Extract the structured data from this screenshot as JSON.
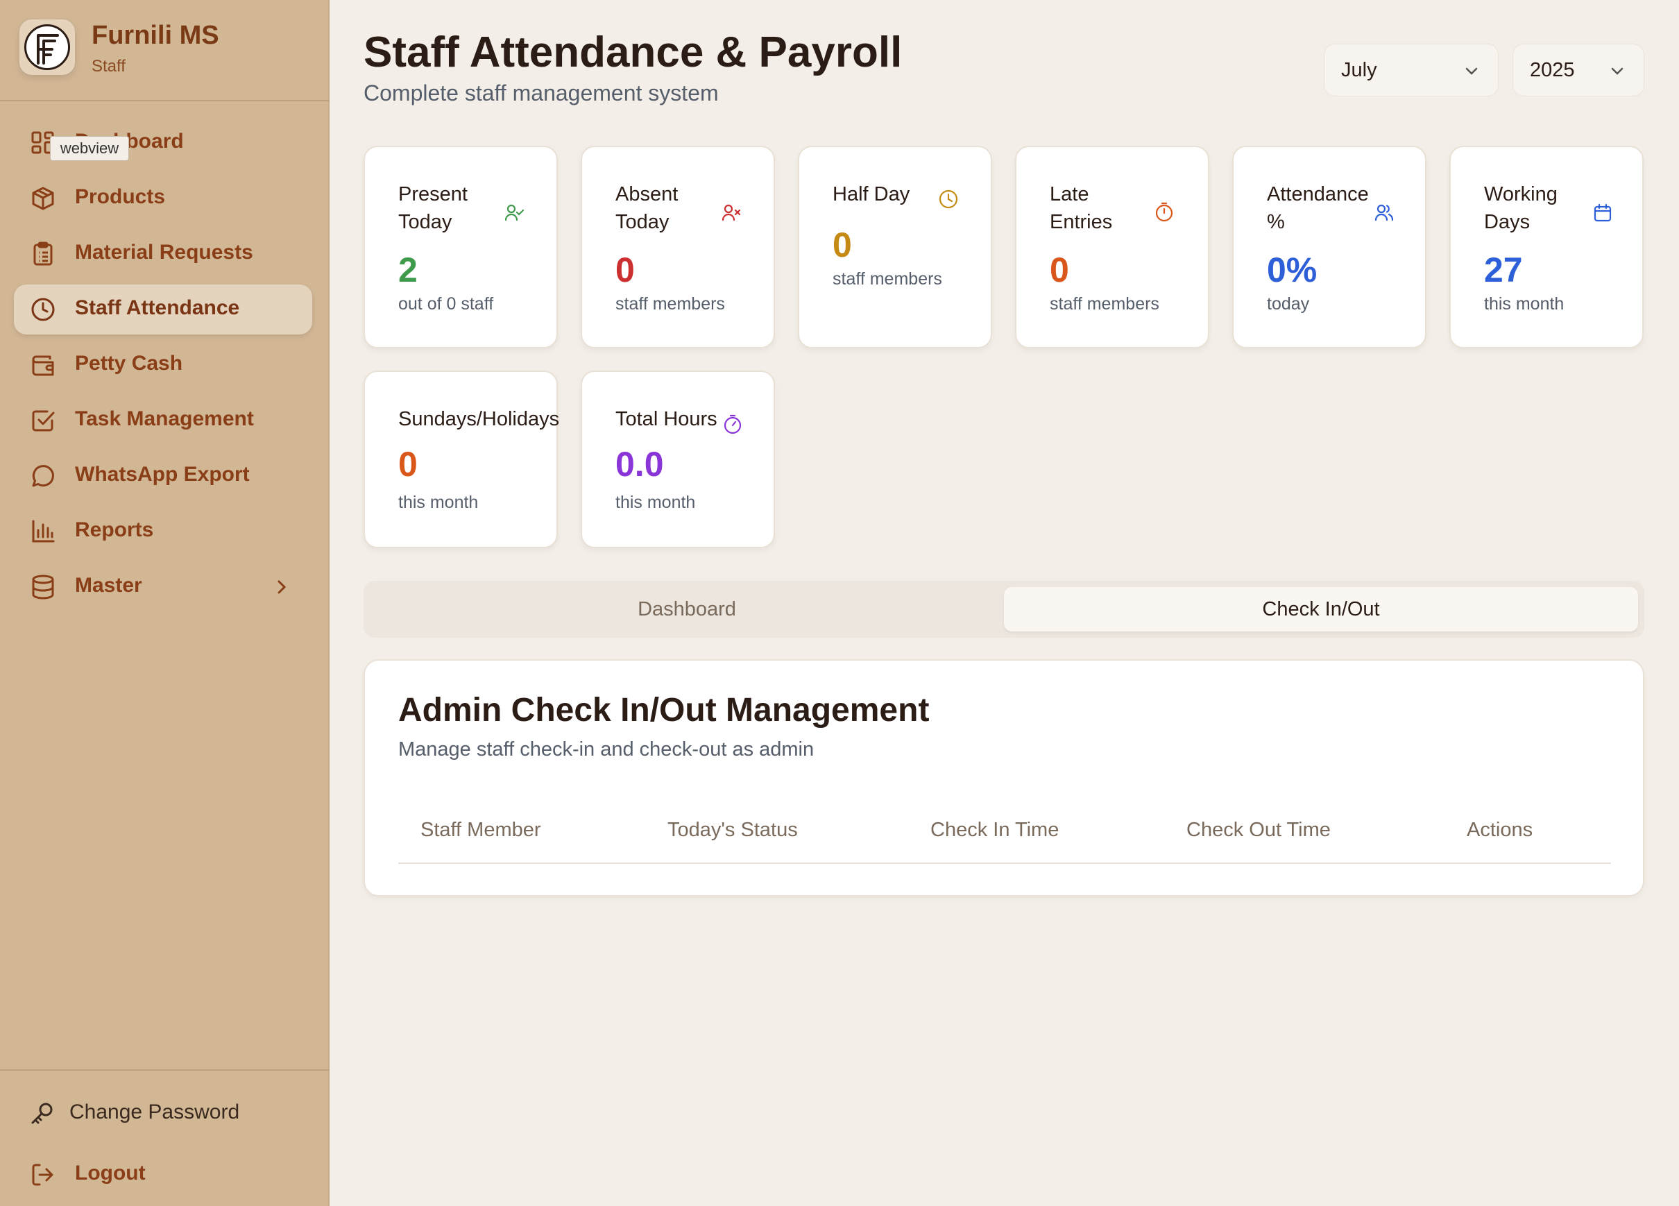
{
  "brand": {
    "name": "Furnili MS",
    "subtitle": "Staff"
  },
  "tooltip": "webview",
  "nav": {
    "items": [
      {
        "label": "Dashboard",
        "icon": "dashboard-icon"
      },
      {
        "label": "Products",
        "icon": "box-icon"
      },
      {
        "label": "Material Requests",
        "icon": "clipboard-icon"
      },
      {
        "label": "Staff Attendance",
        "icon": "clock-icon",
        "active": true
      },
      {
        "label": "Petty Cash",
        "icon": "wallet-icon"
      },
      {
        "label": "Task Management",
        "icon": "checkbox-icon"
      },
      {
        "label": "WhatsApp Export",
        "icon": "chat-icon"
      },
      {
        "label": "Reports",
        "icon": "bar-chart-icon"
      },
      {
        "label": "Master",
        "icon": "database-icon"
      }
    ],
    "footer": [
      {
        "label": "Change Password",
        "icon": "key-icon"
      },
      {
        "label": "Logout",
        "icon": "logout-icon"
      }
    ]
  },
  "header": {
    "title": "Staff Attendance & Payroll",
    "subtitle": "Complete staff management system",
    "month": "July",
    "year": "2025"
  },
  "stats": [
    {
      "label": "Present\nToday",
      "value": "2",
      "note": "out of 0 staff",
      "color": "#3f9a4b",
      "icon": "user-check-icon"
    },
    {
      "label": "Absent\nToday",
      "value": "0",
      "note": "staff members",
      "color": "#cc2f2f",
      "icon": "user-x-icon"
    },
    {
      "label": "Half Day",
      "value": "0",
      "note": "staff members",
      "color": "#c48a14",
      "icon": "clock-icon"
    },
    {
      "label": "Late\nEntries",
      "value": "0",
      "note": "staff members",
      "color": "#d9571a",
      "icon": "timer-icon"
    },
    {
      "label": "Attendance\n%",
      "value": "0%",
      "note": "today",
      "color": "#2d5fd9",
      "icon": "users-icon"
    },
    {
      "label": "Working\nDays",
      "value": "27",
      "note": "this month",
      "color": "#2d5fd9",
      "icon": "calendar-icon"
    },
    {
      "label": "Sundays/Holidays",
      "value": "0",
      "note": "this month",
      "color": "#d9571a",
      "icon": ""
    },
    {
      "label": "Total Hours",
      "value": "0.0",
      "note": "this month",
      "color": "#8a35d8",
      "icon": "stopwatch-icon"
    }
  ],
  "tabs": {
    "dashboard": "Dashboard",
    "checkinout": "Check In/Out"
  },
  "panel": {
    "title": "Admin Check In/Out Management",
    "subtitle": "Manage staff check-in and check-out as admin",
    "columns": [
      "Staff Member",
      "Today's Status",
      "Check In Time",
      "Check Out Time",
      "Actions"
    ]
  }
}
